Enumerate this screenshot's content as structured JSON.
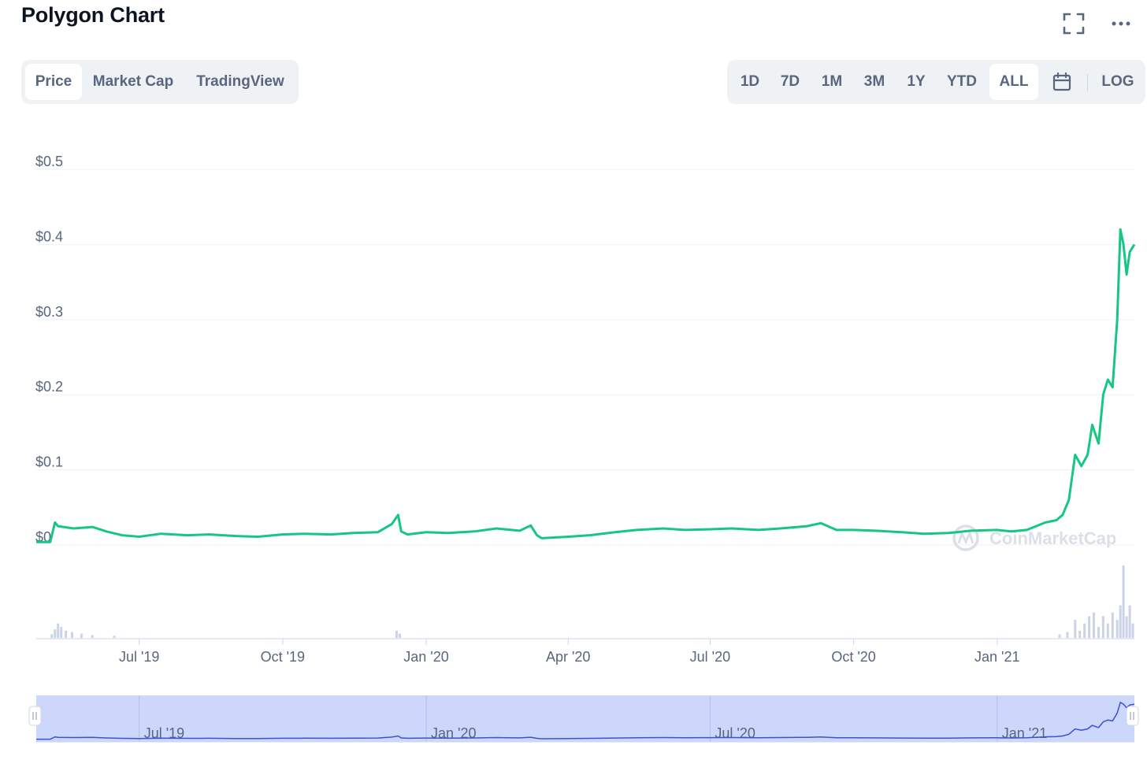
{
  "header": {
    "title": "Polygon Chart",
    "fullscreen_icon": "fullscreen-icon",
    "more_icon": "more-icon"
  },
  "tabs_left": [
    {
      "label": "Price",
      "active": true
    },
    {
      "label": "Market Cap",
      "active": false
    },
    {
      "label": "TradingView",
      "active": false
    }
  ],
  "tabs_right": [
    {
      "label": "1D",
      "active": false
    },
    {
      "label": "7D",
      "active": false
    },
    {
      "label": "1M",
      "active": false
    },
    {
      "label": "3M",
      "active": false
    },
    {
      "label": "1Y",
      "active": false
    },
    {
      "label": "YTD",
      "active": false
    },
    {
      "label": "ALL",
      "active": true
    }
  ],
  "calendar_icon": "calendar-icon",
  "log_label": "LOG",
  "colors": {
    "line": "#16c784",
    "grid": "#eff2f5",
    "axis_text": "#58667e",
    "navigator_fill": "#cdd6fb",
    "navigator_line": "#3b51d8",
    "volume": "#cbd3e6"
  },
  "chart_data": {
    "type": "line",
    "title": "Polygon Chart",
    "watermark": "CoinMarketCap",
    "y_ticks": [
      "$0.5",
      "$0.4",
      "$0.3",
      "$0.2",
      "$0.1",
      "$0"
    ],
    "ylim": [
      0,
      0.5
    ],
    "x_ticks": [
      "Jul '19",
      "Oct '19",
      "Jan '20",
      "Apr '20",
      "Jul '20",
      "Oct '20",
      "Jan '21"
    ],
    "x_tick_dates": [
      "2019-07-01",
      "2019-10-01",
      "2020-01-01",
      "2020-04-01",
      "2020-07-01",
      "2020-10-01",
      "2021-01-01"
    ],
    "xlim": [
      "2019-04-26",
      "2021-03-30"
    ],
    "navigator_ticks": [
      "Jul '19",
      "Jan '20",
      "Jul '20",
      "Jan '21"
    ],
    "series": [
      {
        "x": [
          "2019-04-26",
          "2019-05-05",
          "2019-05-08",
          "2019-05-10",
          "2019-05-20",
          "2019-06-01",
          "2019-06-10",
          "2019-06-20",
          "2019-07-01",
          "2019-07-15",
          "2019-08-01",
          "2019-08-15",
          "2019-09-01",
          "2019-09-15",
          "2019-10-01",
          "2019-10-15",
          "2019-11-01",
          "2019-11-15",
          "2019-12-01",
          "2019-12-10",
          "2019-12-14",
          "2019-12-16",
          "2019-12-20",
          "2020-01-01",
          "2020-01-15",
          "2020-02-01",
          "2020-02-15",
          "2020-03-01",
          "2020-03-08",
          "2020-03-12",
          "2020-03-15",
          "2020-04-01",
          "2020-04-15",
          "2020-05-01",
          "2020-05-15",
          "2020-06-01",
          "2020-06-15",
          "2020-07-01",
          "2020-07-15",
          "2020-08-01",
          "2020-08-15",
          "2020-09-01",
          "2020-09-10",
          "2020-09-20",
          "2020-10-01",
          "2020-10-15",
          "2020-11-01",
          "2020-11-15",
          "2020-12-01",
          "2020-12-15",
          "2021-01-01",
          "2021-01-10",
          "2021-01-20",
          "2021-02-01",
          "2021-02-08",
          "2021-02-12",
          "2021-02-16",
          "2021-02-20",
          "2021-02-24",
          "2021-02-28",
          "2021-03-03",
          "2021-03-07",
          "2021-03-10",
          "2021-03-13",
          "2021-03-16",
          "2021-03-19",
          "2021-03-21",
          "2021-03-23",
          "2021-03-25",
          "2021-03-27",
          "2021-03-30"
        ],
        "y": [
          0.004,
          0.004,
          0.03,
          0.025,
          0.022,
          0.024,
          0.018,
          0.013,
          0.011,
          0.015,
          0.013,
          0.014,
          0.012,
          0.011,
          0.014,
          0.015,
          0.014,
          0.016,
          0.017,
          0.028,
          0.04,
          0.018,
          0.014,
          0.017,
          0.016,
          0.018,
          0.022,
          0.019,
          0.026,
          0.013,
          0.009,
          0.011,
          0.013,
          0.017,
          0.02,
          0.022,
          0.02,
          0.021,
          0.022,
          0.02,
          0.022,
          0.025,
          0.029,
          0.02,
          0.02,
          0.019,
          0.017,
          0.015,
          0.016,
          0.019,
          0.02,
          0.018,
          0.02,
          0.03,
          0.033,
          0.04,
          0.06,
          0.12,
          0.105,
          0.12,
          0.16,
          0.135,
          0.2,
          0.22,
          0.21,
          0.3,
          0.42,
          0.4,
          0.36,
          0.39,
          0.4
        ]
      }
    ],
    "volume": {
      "x": [
        "2019-05-06",
        "2019-05-08",
        "2019-05-10",
        "2019-05-12",
        "2019-05-15",
        "2019-05-19",
        "2019-05-25",
        "2019-06-01",
        "2019-06-15",
        "2019-12-13",
        "2019-12-15",
        "2021-02-10",
        "2021-02-15",
        "2021-02-20",
        "2021-02-23",
        "2021-02-26",
        "2021-03-01",
        "2021-03-04",
        "2021-03-07",
        "2021-03-10",
        "2021-03-13",
        "2021-03-16",
        "2021-03-19",
        "2021-03-21",
        "2021-03-23",
        "2021-03-25",
        "2021-03-27",
        "2021-03-29"
      ],
      "v": [
        0.05,
        0.12,
        0.2,
        0.15,
        0.1,
        0.08,
        0.06,
        0.04,
        0.03,
        0.1,
        0.06,
        0.05,
        0.08,
        0.25,
        0.1,
        0.2,
        0.3,
        0.35,
        0.15,
        0.3,
        0.2,
        0.35,
        0.25,
        0.45,
        1.0,
        0.3,
        0.45,
        0.2
      ]
    }
  }
}
